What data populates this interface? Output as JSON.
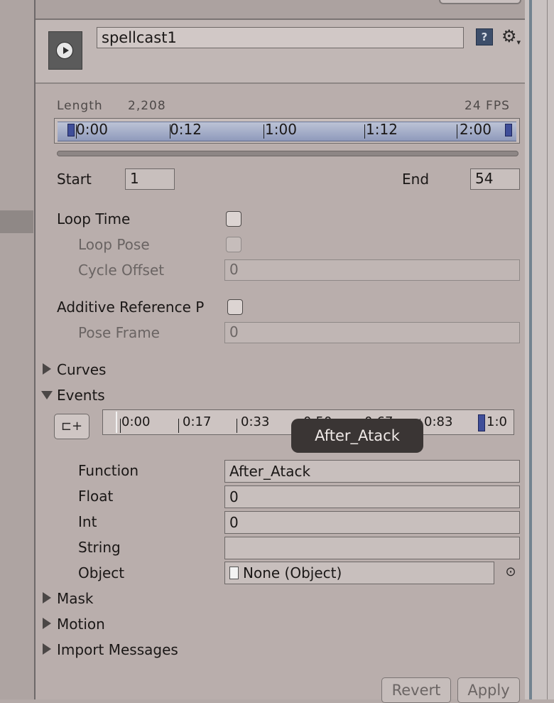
{
  "clip": {
    "name": "spellcast1",
    "length_label": "Length",
    "length_value": "2,208",
    "fps": "24 FPS",
    "timeline_ticks": [
      "0:00",
      "0:12",
      "1:00",
      "1:12",
      "2:00"
    ],
    "start_label": "Start",
    "start_value": "1",
    "end_label": "End",
    "end_value": "54"
  },
  "settings": {
    "loop_time": {
      "label": "Loop Time",
      "checked": false
    },
    "loop_pose": {
      "label": "Loop Pose",
      "checked": false
    },
    "cycle_offset": {
      "label": "Cycle Offset",
      "value": "0"
    },
    "additive_ref": {
      "label": "Additive Reference P",
      "checked": false
    },
    "pose_frame": {
      "label": "Pose Frame",
      "value": "0"
    }
  },
  "sections": {
    "curves": "Curves",
    "events": "Events",
    "mask": "Mask",
    "motion": "Motion",
    "import_messages": "Import Messages"
  },
  "events": {
    "ticks": [
      "0:00",
      "0:17",
      "0:33",
      "0:50",
      "0:67",
      "0:83",
      "1:0"
    ],
    "tooltip": "After_Atack",
    "function_label": "Function",
    "function_value": "After_Atack",
    "float_label": "Float",
    "float_value": "0",
    "int_label": "Int",
    "int_value": "0",
    "string_label": "String",
    "string_value": "",
    "object_label": "Object",
    "object_value": "None (Object)"
  },
  "buttons": {
    "revert": "Revert",
    "apply": "Apply"
  },
  "icons": {
    "play": "play-icon",
    "help": "help-book-icon",
    "settings": "gear-icon",
    "add_event": "add-event-icon",
    "object_picker": "object-picker-icon"
  },
  "colors": {
    "panel_bg": "#b9aeac",
    "timeline_blue": "#8f9abb",
    "marker_blue": "#3f4e99"
  }
}
